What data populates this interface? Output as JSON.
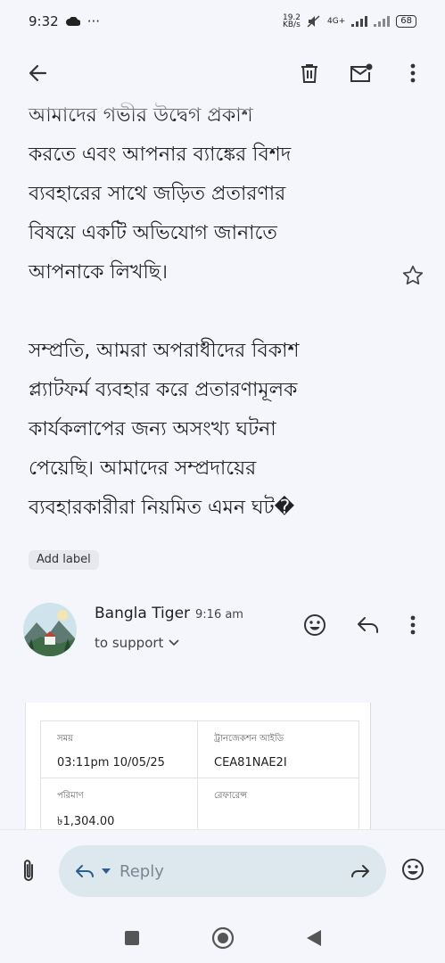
{
  "status_bar": {
    "time": "9:32",
    "dots": "···",
    "speed": "19.2\nKB/s",
    "network": "4G+",
    "battery": "68"
  },
  "email": {
    "paragraph1_lines": [
      "আমাদের গভীর উদ্বেগ প্রকাশ",
      "করতে এবং আপনার ব্যাঙ্কের বিশদ",
      "ব্যবহারের সাথে জড়িত প্রতারণার",
      "বিষয়ে একটি অভিযোগ জানাতে",
      "আপনাকে লিখছি।"
    ],
    "paragraph2_lines": [
      "সম্প্রতি, আমরা অপরাধীদের বিকাশ",
      "প্ল্যাটফর্ম ব্যবহার করে প্রতারণামূলক",
      "কার্যকলাপের জন্য অসংখ্য ঘটনা",
      "পেয়েছি। আমাদের সম্প্রদায়ের",
      "ব্যবহারকারীরা নিয়মিত এমন ঘট�"
    ],
    "label_chip": "Add label"
  },
  "message": {
    "sender": "Bangla Tiger",
    "time": "9:16 am",
    "recipient": "to support"
  },
  "receipt": {
    "cells": [
      {
        "label": "সময়",
        "value": "03:11pm 10/05/25"
      },
      {
        "label": "ট্রানজেকশন আইডি",
        "value": "CEA81NAE2I"
      },
      {
        "label": "পরিমাণ",
        "value": "৳1,304.00"
      },
      {
        "label": "রেফারেন্স",
        "value": ""
      }
    ]
  },
  "reply": {
    "placeholder": "Reply"
  },
  "colors": {
    "background": "#f4f6fb",
    "reply_pill": "#dde7ee",
    "chip": "#e6e8ee"
  }
}
